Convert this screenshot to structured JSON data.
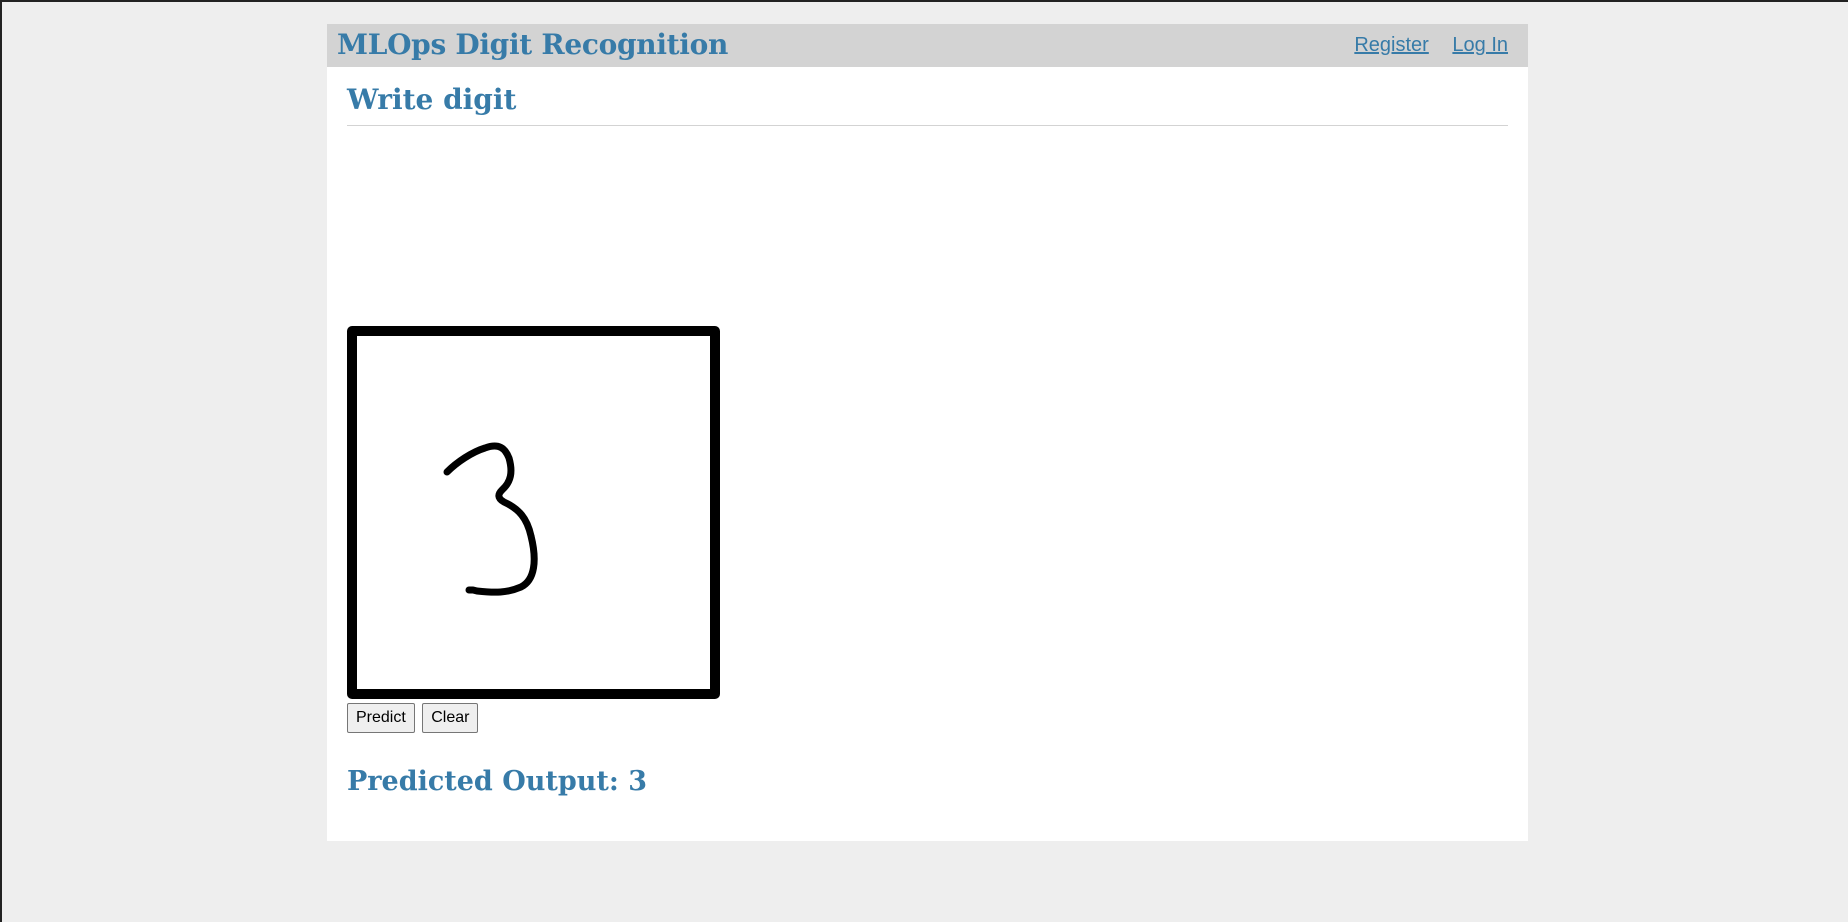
{
  "header": {
    "app_title": "MLOps Digit Recognition",
    "links": {
      "register": "Register",
      "login": "Log In"
    }
  },
  "main": {
    "section_title": "Write digit",
    "canvas": {
      "drawn_digit": "3",
      "stroke_color": "#000000",
      "border_color": "#000000"
    },
    "buttons": {
      "predict": "Predict",
      "clear": "Clear"
    },
    "result": {
      "label": "Predicted Output:",
      "value": "3"
    }
  },
  "colors": {
    "accent": "#377ba8",
    "nav_background": "#d3d3d3",
    "page_background": "#eeeeee",
    "content_background": "#ffffff"
  }
}
